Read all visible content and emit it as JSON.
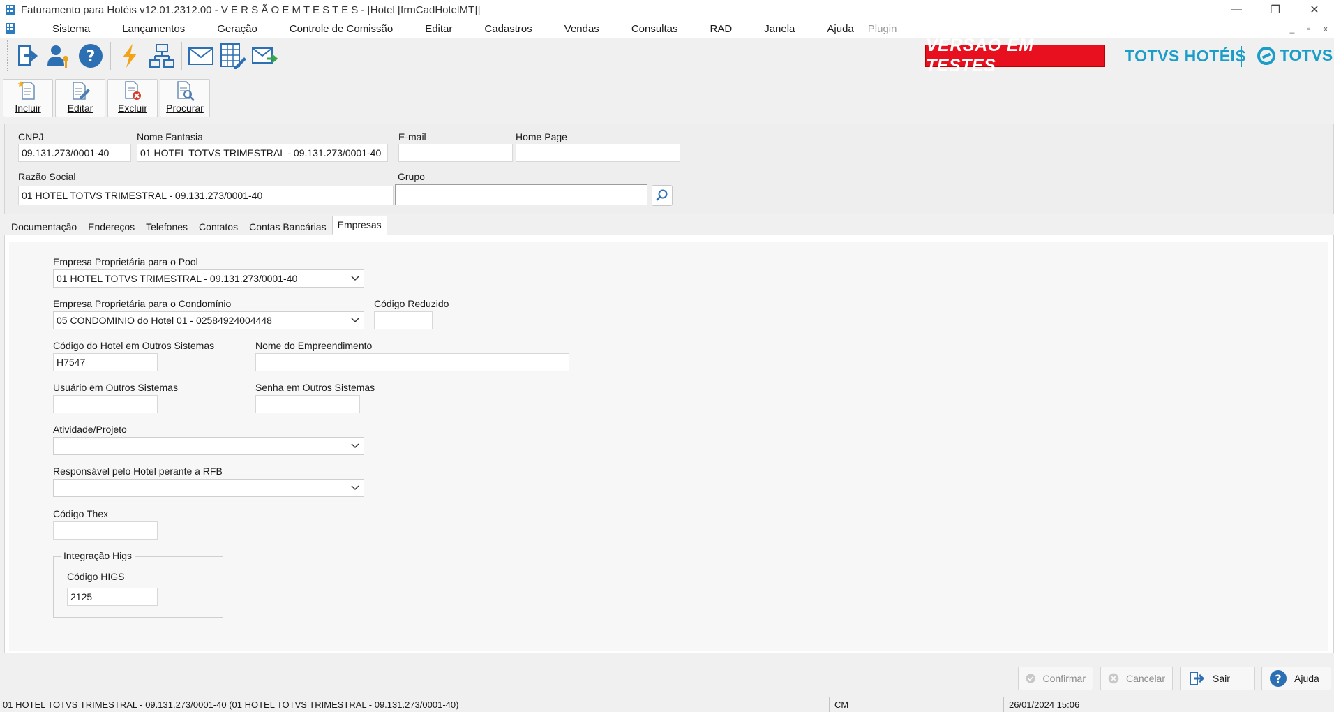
{
  "window": {
    "title": "Faturamento para Hotéis v12.01.2312.00 - V E R S Ã O  E M  T E S T E S  - [Hotel [frmCadHotelMT]]",
    "min_glyph": "—",
    "max_glyph": "❐",
    "close_glyph": "✕"
  },
  "menu": {
    "items": [
      "Sistema",
      "Lançamentos",
      "Geração",
      "Controle de Comissão",
      "Editar",
      "Cadastros",
      "Vendas",
      "Consultas",
      "RAD",
      "Janela",
      "Ajuda"
    ],
    "plugin": "Plugin",
    "mdi_min": "_",
    "mdi_restore": "▫",
    "mdi_close": "x"
  },
  "brand": {
    "banner": "VERSÃO EM TESTES",
    "product": "TOTVS HOTÉIS",
    "company": "TOTVS",
    "banner_color": "#e8101e",
    "accent_color": "#1a9ec9"
  },
  "toolbar_icons": [
    "exit-icon",
    "user-key-icon",
    "help-icon",
    "lightning-icon",
    "network-icon",
    "mail-icon",
    "spreadsheet-edit-icon",
    "mail-send-icon"
  ],
  "actions": {
    "incluir": "Incluir",
    "editar": "Editar",
    "excluir": "Excluir",
    "procurar": "Procurar"
  },
  "header": {
    "cnpj_label": "CNPJ",
    "cnpj_value": "09.131.273/0001-40",
    "fantasia_label": "Nome Fantasia",
    "fantasia_value": "01 HOTEL TOTVS TRIMESTRAL - 09.131.273/0001-40",
    "email_label": "E-mail",
    "email_value": "",
    "homepage_label": "Home Page",
    "homepage_value": "",
    "razao_label": "Razão Social",
    "razao_value": "01 HOTEL TOTVS TRIMESTRAL - 09.131.273/0001-40",
    "grupo_label": "Grupo",
    "grupo_value": ""
  },
  "tabs": [
    "Documentação",
    "Endereços",
    "Telefones",
    "Contatos",
    "Contas Bancárias",
    "Empresas"
  ],
  "active_tab": "Empresas",
  "empresas": {
    "pool_label": "Empresa Proprietária para o Pool",
    "pool_value": "01 HOTEL TOTVS TRIMESTRAL -  09.131.273/0001-40",
    "condominio_label": "Empresa Proprietária para o Condomínio",
    "condominio_value": "05 CONDOMINIO do Hotel 01 - 02584924004448",
    "codigo_reduzido_label": "Código Reduzido",
    "codigo_reduzido_value": "",
    "codigo_hotel_label": "Código do Hotel em Outros Sistemas",
    "codigo_hotel_value": "H7547",
    "nome_empreendimento_label": "Nome do Empreendimento",
    "nome_empreendimento_value": "",
    "usuario_label": "Usuário em Outros Sistemas",
    "usuario_value": "",
    "senha_label": "Senha em Outros Sistemas",
    "senha_value": "",
    "atividade_label": "Atividade/Projeto",
    "atividade_value": "",
    "responsavel_label": "Responsável pelo Hotel perante a RFB",
    "responsavel_value": "",
    "thex_label": "Código Thex",
    "thex_value": "",
    "higs_group_label": "Integração Higs",
    "higs_label": "Código HIGS",
    "higs_value": "2125"
  },
  "bottom": {
    "confirmar": "Confirmar",
    "cancelar": "Cancelar",
    "sair": "Sair",
    "ajuda": "Ajuda"
  },
  "status": {
    "record": "01 HOTEL TOTVS TRIMESTRAL -  09.131.273/0001-40 (01 HOTEL TOTVS TRIMESTRAL - 09.131.273/0001-40)",
    "user": "CM",
    "datetime": "26/01/2024 15:06"
  }
}
